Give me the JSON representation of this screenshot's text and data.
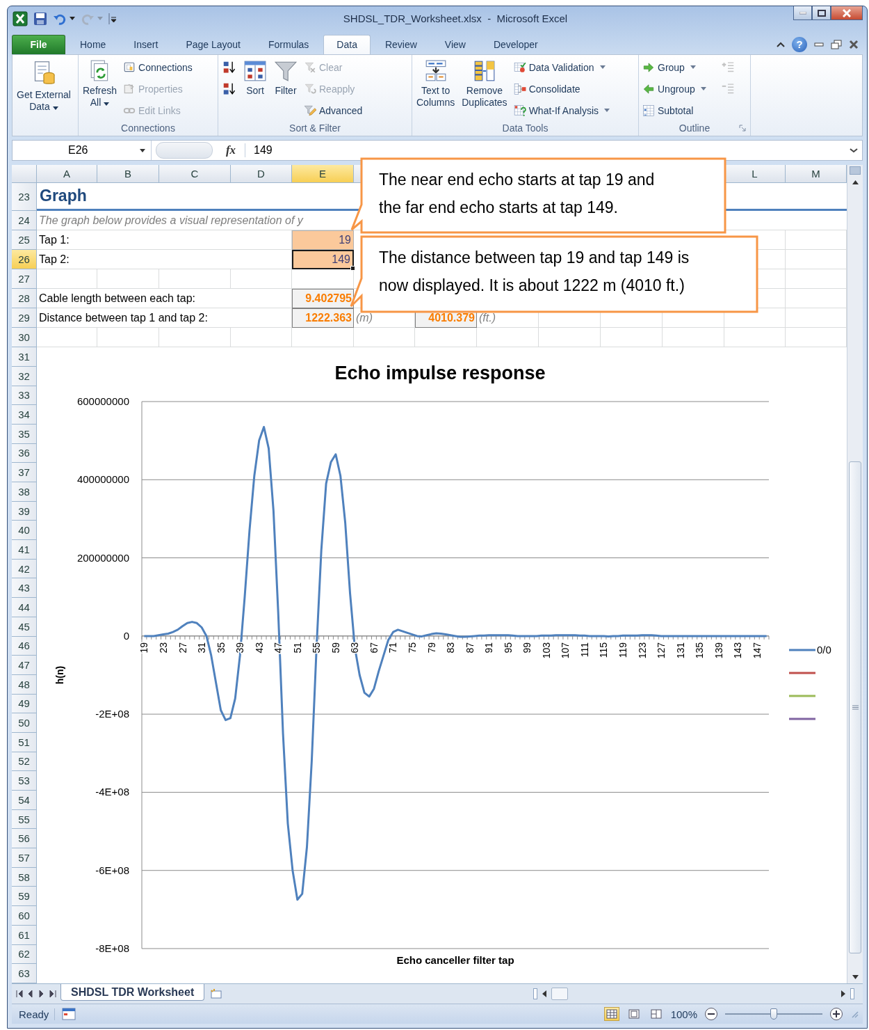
{
  "window": {
    "title": "SHDSL_TDR_Worksheet.xlsx  -  Microsoft Excel"
  },
  "tabs": [
    {
      "label": "File",
      "kind": "backstage",
      "selected": false
    },
    {
      "label": "Home",
      "kind": "tab",
      "selected": false
    },
    {
      "label": "Insert",
      "kind": "tab",
      "selected": false
    },
    {
      "label": "Page Layout",
      "kind": "tab",
      "selected": false
    },
    {
      "label": "Formulas",
      "kind": "tab",
      "selected": false
    },
    {
      "label": "Data",
      "kind": "tab",
      "selected": true
    },
    {
      "label": "Review",
      "kind": "tab",
      "selected": false
    },
    {
      "label": "View",
      "kind": "tab",
      "selected": false
    },
    {
      "label": "Developer",
      "kind": "tab",
      "selected": false
    }
  ],
  "help": "?",
  "ribbon": {
    "groups": [
      {
        "launcher": false,
        "items": [
          {
            "kind": "large",
            "lines": [
              "Get External",
              "Data"
            ],
            "dropdown": true,
            "disabled": false
          }
        ]
      },
      {
        "label": "Connections",
        "launcher": false,
        "items": [
          {
            "kind": "large",
            "lines": [
              "Refresh",
              "All"
            ],
            "dropdown": true,
            "disabled": false
          },
          {
            "kind": "stack",
            "items": [
              {
                "kind": "small",
                "label": "Connections",
                "dropdown": false,
                "disabled": false
              },
              {
                "kind": "small",
                "label": "Properties",
                "dropdown": false,
                "disabled": true
              },
              {
                "kind": "small",
                "label": "Edit Links",
                "dropdown": false,
                "disabled": true
              }
            ]
          }
        ]
      },
      {
        "label": "Sort & Filter",
        "launcher": false,
        "items": [
          {
            "kind": "stack",
            "items": [
              {
                "kind": "icon",
                "dropdown": false,
                "disabled": false
              },
              {
                "kind": "icon",
                "dropdown": false,
                "disabled": false
              }
            ]
          },
          {
            "kind": "large",
            "lines": [
              "Sort"
            ],
            "dropdown": false,
            "disabled": false
          },
          {
            "kind": "large",
            "lines": [
              "Filter"
            ],
            "dropdown": false,
            "disabled": false
          },
          {
            "kind": "stack",
            "items": [
              {
                "kind": "small",
                "label": "Clear",
                "dropdown": false,
                "disabled": true
              },
              {
                "kind": "small",
                "label": "Reapply",
                "dropdown": false,
                "disabled": true
              },
              {
                "kind": "small",
                "label": "Advanced",
                "dropdown": false,
                "disabled": false
              }
            ]
          }
        ]
      },
      {
        "label": "Data Tools",
        "launcher": false,
        "items": [
          {
            "kind": "large",
            "lines": [
              "Text to",
              "Columns"
            ],
            "dropdown": false,
            "disabled": false
          },
          {
            "kind": "large",
            "lines": [
              "Remove",
              "Duplicates"
            ],
            "dropdown": false,
            "disabled": false
          },
          {
            "kind": "stack",
            "items": [
              {
                "kind": "small",
                "label": "Data Validation",
                "dropdown": true,
                "disabled": false
              },
              {
                "kind": "small",
                "label": "Consolidate",
                "dropdown": false,
                "disabled": false
              },
              {
                "kind": "small",
                "label": "What-If Analysis",
                "dropdown": true,
                "disabled": false
              }
            ]
          }
        ]
      },
      {
        "label": "Outline",
        "launcher": true,
        "items": [
          {
            "kind": "stack",
            "items": [
              {
                "kind": "small",
                "label": "Group",
                "dropdown": true,
                "disabled": false
              },
              {
                "kind": "small",
                "label": "Ungroup",
                "dropdown": true,
                "disabled": false
              },
              {
                "kind": "small",
                "label": "Subtotal",
                "dropdown": false,
                "disabled": false
              }
            ]
          },
          {
            "kind": "stack",
            "items": [
              {
                "kind": "icon",
                "dropdown": false,
                "disabled": true
              },
              {
                "kind": "icon",
                "dropdown": false,
                "disabled": true
              }
            ]
          }
        ]
      }
    ]
  },
  "formula_bar": {
    "name_box": "E26",
    "function_label": "fx",
    "value": "149"
  },
  "columns": [
    {
      "label": "A",
      "selected": false
    },
    {
      "label": "B",
      "selected": false
    },
    {
      "label": "C",
      "selected": false
    },
    {
      "label": "D",
      "selected": false
    },
    {
      "label": "E",
      "selected": true
    },
    {
      "label": "L",
      "selected": false
    },
    {
      "label": "M",
      "selected": false
    }
  ],
  "row_headers": [
    {
      "label": "23",
      "selected": false
    },
    {
      "label": "24",
      "selected": false
    },
    {
      "label": "25",
      "selected": false
    },
    {
      "label": "26",
      "selected": true
    },
    {
      "label": "27",
      "selected": false
    },
    {
      "label": "28",
      "selected": false
    },
    {
      "label": "29",
      "selected": false
    },
    {
      "label": "30",
      "selected": false
    },
    {
      "label": "31",
      "selected": false
    },
    {
      "label": "32",
      "selected": false
    },
    {
      "label": "33",
      "selected": false
    },
    {
      "label": "34",
      "selected": false
    },
    {
      "label": "35",
      "selected": false
    },
    {
      "label": "36",
      "selected": false
    },
    {
      "label": "37",
      "selected": false
    },
    {
      "label": "38",
      "selected": false
    },
    {
      "label": "39",
      "selected": false
    },
    {
      "label": "40",
      "selected": false
    },
    {
      "label": "41",
      "selected": false
    },
    {
      "label": "42",
      "selected": false
    },
    {
      "label": "43",
      "selected": false
    },
    {
      "label": "44",
      "selected": false
    },
    {
      "label": "45",
      "selected": false
    },
    {
      "label": "46",
      "selected": false
    },
    {
      "label": "47",
      "selected": false
    },
    {
      "label": "48",
      "selected": false
    },
    {
      "label": "49",
      "selected": false
    },
    {
      "label": "50",
      "selected": false
    },
    {
      "label": "51",
      "selected": false
    },
    {
      "label": "52",
      "selected": false
    },
    {
      "label": "53",
      "selected": false
    },
    {
      "label": "54",
      "selected": false
    },
    {
      "label": "55",
      "selected": false
    },
    {
      "label": "56",
      "selected": false
    },
    {
      "label": "57",
      "selected": false
    },
    {
      "label": "58",
      "selected": false
    },
    {
      "label": "59",
      "selected": false
    },
    {
      "label": "60",
      "selected": false
    },
    {
      "label": "61",
      "selected": false
    },
    {
      "label": "62",
      "selected": false
    },
    {
      "label": "63",
      "selected": false
    }
  ],
  "rows": [
    {
      "kind": "heading",
      "text": "Graph"
    },
    {
      "kind": "note",
      "text": "The graph below provides a visual representation of y"
    },
    {
      "kind": "input",
      "label": "Tap 1:",
      "value": "19",
      "selected": false
    },
    {
      "kind": "input",
      "label": "Tap 2:",
      "value": "149",
      "selected": true
    },
    {
      "kind": "blank"
    },
    {
      "kind": "result",
      "label": "Cable length between each tap:",
      "value": "9.402795"
    },
    {
      "kind": "result",
      "label": "Distance between tap 1 and tap 2:",
      "value": "1222.363",
      "unit": "(m)",
      "value_2": "4010.379",
      "unit_2": "(ft.)"
    },
    {
      "kind": "blank"
    }
  ],
  "callouts": [
    {
      "lines": [
        "The near end echo starts at tap 19 and",
        "the far end echo starts at tap 149."
      ]
    },
    {
      "lines": [
        "The distance between tap 19 and tap 149 is",
        "now displayed. It is about 1222 m (4010 ft.)"
      ]
    }
  ],
  "chart": {
    "chart_data": {
      "type": "line",
      "grid": true,
      "title": "Echo impulse response",
      "xlabel": "Echo canceller filter tap",
      "ylabel": "h(n)",
      "x": [
        19,
        20,
        21,
        22,
        23,
        24,
        25,
        26,
        27,
        28,
        29,
        30,
        31,
        32,
        33,
        34,
        35,
        36,
        37,
        38,
        39,
        40,
        41,
        42,
        43,
        44,
        45,
        46,
        47,
        48,
        49,
        50,
        51,
        52,
        53,
        54,
        55,
        56,
        57,
        58,
        59,
        60,
        61,
        62,
        63,
        64,
        65,
        66,
        67,
        68,
        69,
        70,
        71,
        72,
        73,
        74,
        75,
        76,
        77,
        78,
        79,
        80,
        81,
        82,
        83,
        84,
        85,
        86,
        87,
        88,
        89,
        90,
        91,
        92,
        93,
        94,
        95,
        96,
        97,
        98,
        99,
        100,
        101,
        102,
        103,
        104,
        105,
        106,
        107,
        108,
        109,
        110,
        111,
        112,
        113,
        114,
        115,
        116,
        117,
        118,
        119,
        120,
        121,
        122,
        123,
        124,
        125,
        126,
        127,
        128,
        129,
        130,
        131,
        132,
        133,
        134,
        135,
        136,
        137,
        138,
        139,
        140,
        141,
        142,
        143,
        144,
        145,
        146,
        147,
        148,
        149
      ],
      "series": [
        {
          "name": "0/0",
          "color": "#4f81bd",
          "values": [
            0,
            0,
            0,
            2000000.0,
            4000000.0,
            6000000.0,
            10000000.0,
            16000000.0,
            25000000.0,
            33000000.0,
            36000000.0,
            33000000.0,
            22000000.0,
            0,
            -50000000.0,
            -120000000.0,
            -190000000.0,
            -215000000.0,
            -210000000.0,
            -160000000.0,
            -50000000.0,
            100000000.0,
            270000000.0,
            410000000.0,
            500000000.0,
            535000000.0,
            480000000.0,
            320000000.0,
            60000000.0,
            -250000000.0,
            -480000000.0,
            -600000000.0,
            -675000000.0,
            -660000000.0,
            -540000000.0,
            -320000000.0,
            -30000000.0,
            220000000.0,
            390000000.0,
            445000000.0,
            465000000.0,
            410000000.0,
            290000000.0,
            110000000.0,
            -30000000.0,
            -100000000.0,
            -145000000.0,
            -155000000.0,
            -135000000.0,
            -90000000.0,
            -50000000.0,
            -10000000.0,
            10000000.0,
            16000000.0,
            12000000.0,
            8000000.0,
            4000000.0,
            0,
            -1000000.0,
            2000000.0,
            5000000.0,
            7000000.0,
            6000000.0,
            4000000.0,
            2000000.0,
            0,
            -2000000.0,
            -2000000.0,
            -1000000.0,
            0,
            1000000.0,
            1000000.0,
            2000000.0,
            2000000.0,
            2000000.0,
            2000000.0,
            2000000.0,
            1000000.0,
            0,
            0,
            0,
            0,
            0,
            1000000.0,
            1000000.0,
            1000000.0,
            2000000.0,
            2000000.0,
            2000000.0,
            2000000.0,
            2000000.0,
            1000000.0,
            1000000.0,
            0,
            0,
            0,
            0,
            -1000000.0,
            0,
            0,
            1000000.0,
            1000000.0,
            1000000.0,
            1000000.0,
            2000000.0,
            2000000.0,
            2000000.0,
            1000000.0,
            0,
            0,
            0,
            0,
            0,
            0,
            0,
            0,
            0,
            0,
            0,
            0,
            0,
            0,
            0,
            0,
            0,
            0,
            0,
            0,
            0,
            0,
            0
          ]
        }
      ],
      "xlim": [
        19,
        149
      ],
      "ylim": [
        -800000000,
        600000000
      ],
      "xticks": [
        19,
        23,
        27,
        31,
        35,
        39,
        43,
        47,
        51,
        55,
        59,
        63,
        67,
        71,
        75,
        79,
        83,
        87,
        91,
        95,
        99,
        103,
        107,
        111,
        115,
        119,
        123,
        127,
        131,
        135,
        139,
        143,
        147
      ],
      "yticks": [
        {
          "value": 600000000,
          "label": "600000000"
        },
        {
          "value": 400000000,
          "label": "400000000"
        },
        {
          "value": 200000000,
          "label": "200000000"
        },
        {
          "value": 0,
          "label": "0"
        },
        {
          "value": -200000000,
          "label": "-2E+08"
        },
        {
          "value": -400000000,
          "label": "-4E+08"
        },
        {
          "value": -600000000,
          "label": "-6E+08"
        },
        {
          "value": -800000000,
          "label": "-8E+08"
        }
      ]
    },
    "legend_extra": [
      {
        "color": "#c0504d"
      },
      {
        "color": "#9bbb59"
      },
      {
        "color": "#8064a2"
      }
    ]
  },
  "sheet_tabs": [
    {
      "label": "SHDSL TDR Worksheet",
      "selected": true
    }
  ],
  "status_bar": {
    "text": "Ready",
    "zoom": "100%",
    "zoom_slider": {
      "level": 0.5
    },
    "view_buttons": [
      {
        "selected": true
      },
      {
        "selected": false
      },
      {
        "selected": false
      }
    ]
  }
}
